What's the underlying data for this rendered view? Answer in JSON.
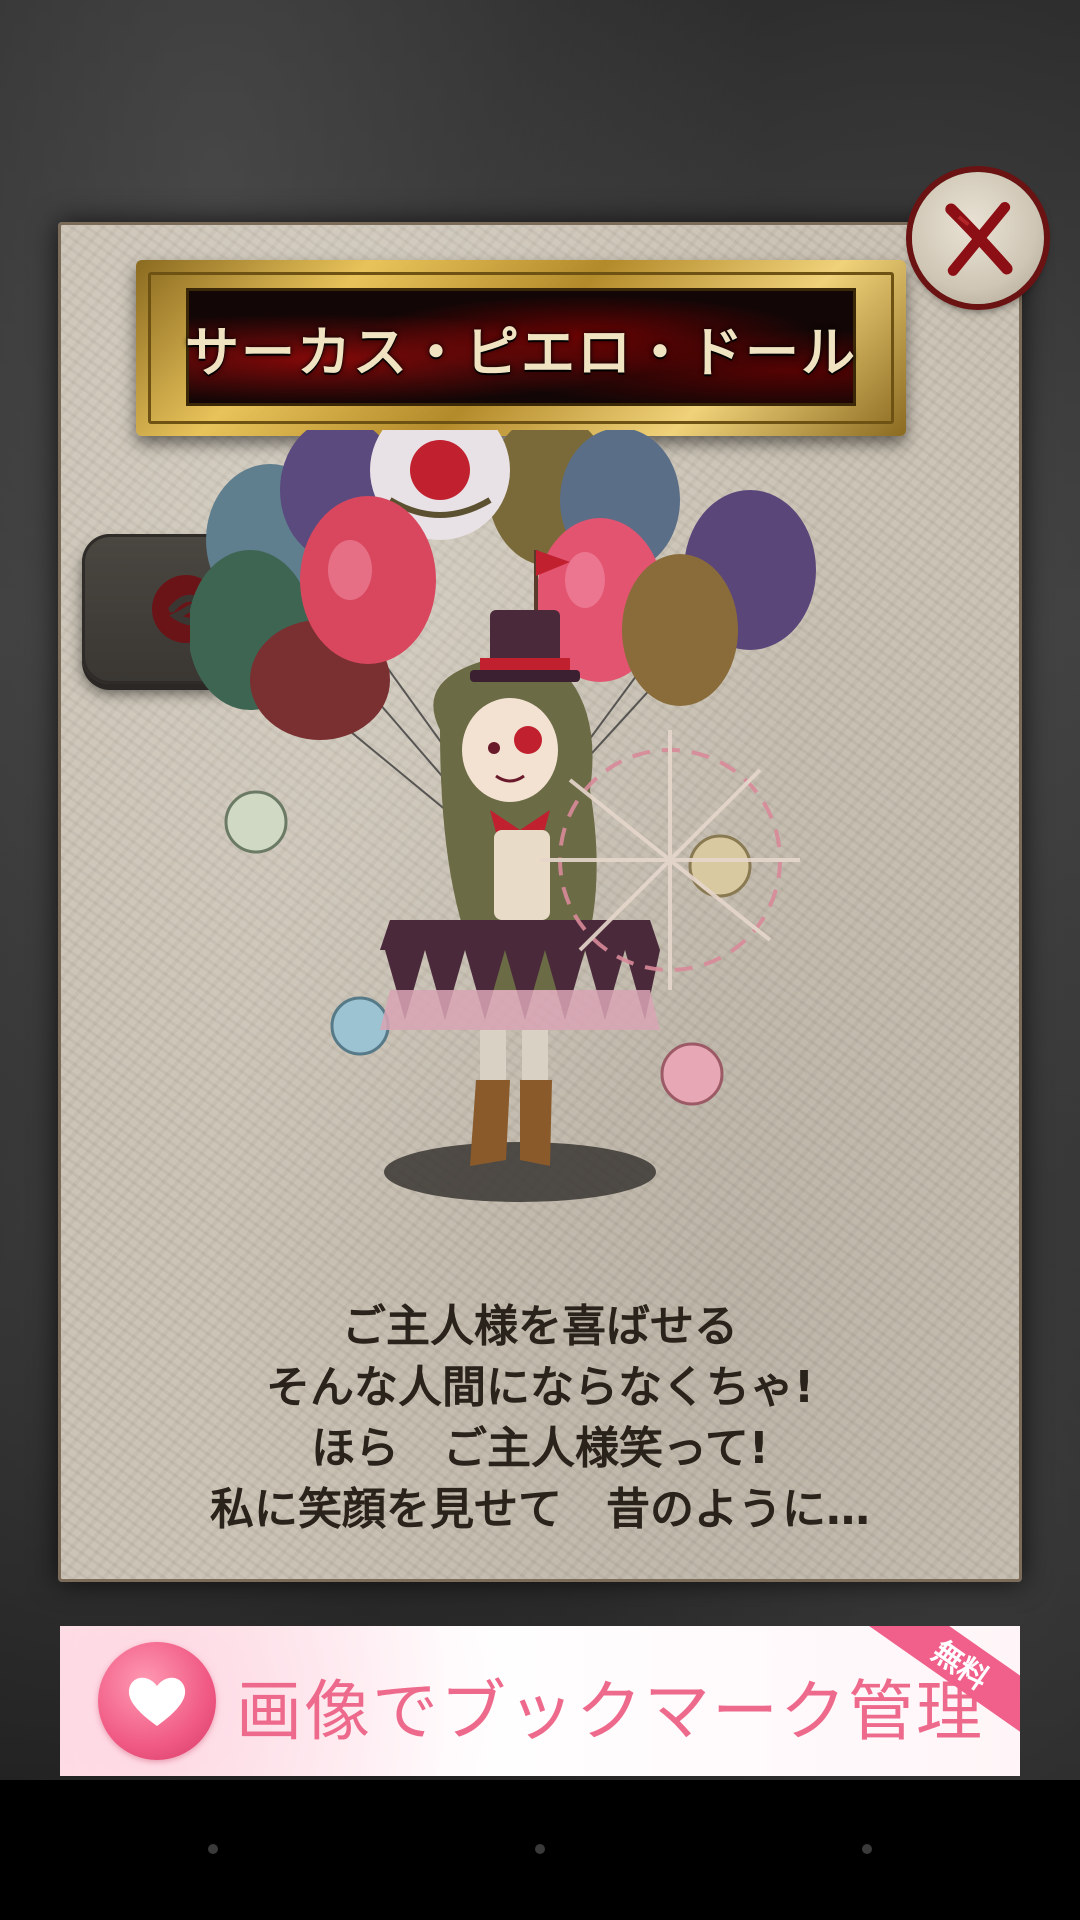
{
  "character": {
    "name": "サーカス・ピエロ・ドール",
    "description_lines": [
      "ご主人様を喜ばせる",
      "そんな人間にならなくちゃ!",
      "ほら　ご主人様笑って!",
      "私に笑顔を見せて　昔のように…"
    ]
  },
  "icons": {
    "close": "close-x-icon",
    "voice": "voice-speaker-icon",
    "ad_logo": "heart-icon"
  },
  "ad": {
    "text": "画像でブックマーク管理",
    "badge": "無料"
  },
  "colors": {
    "title_text": "#efe3c2",
    "accent_red": "#8b0f14",
    "ad_pink": "#ee6a8c",
    "paper": "#c9c1b2"
  }
}
